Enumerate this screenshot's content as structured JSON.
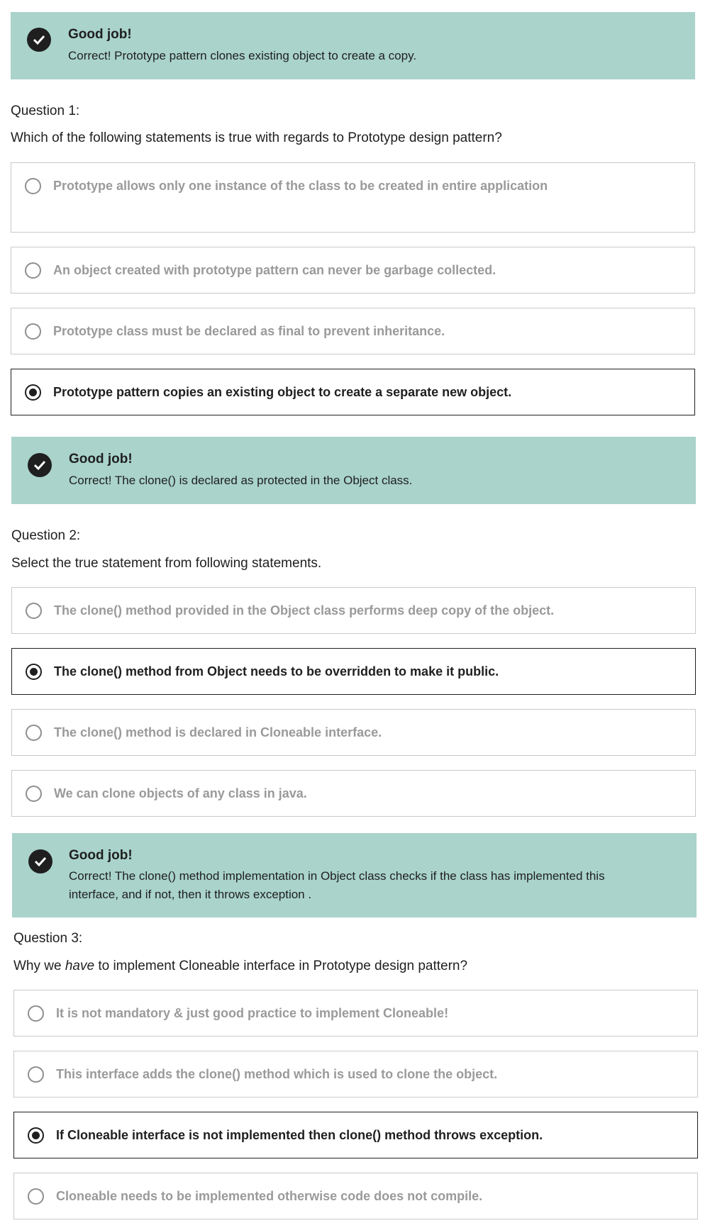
{
  "feedback1": {
    "title": "Good job!",
    "text": "Correct! Prototype pattern clones existing object to create a copy.",
    "icon": "check-circle-icon"
  },
  "q1": {
    "label": "Question 1:",
    "text": "Which of the following statements is true with regards to Prototype design pattern?",
    "options": [
      "Prototype allows only one instance of the class to be created in entire application",
      "An object created with prototype pattern can never be garbage collected.",
      "Prototype class must be declared as final to prevent inheritance.",
      "Prototype pattern copies an existing object to create a separate new object."
    ],
    "selected_index": 3
  },
  "feedback2": {
    "title": "Good job!",
    "text": "Correct! The clone() is declared as protected in the Object class.",
    "icon": "check-circle-icon"
  },
  "q2": {
    "label": "Question 2:",
    "text": "Select the true statement from following statements.",
    "options": [
      "The clone() method provided in the Object class performs deep copy of the object.",
      "The clone() method from Object needs to be overridden to make it public.",
      "The clone() method is declared in Cloneable interface.",
      "We can clone objects of any class in java."
    ],
    "selected_index": 1
  },
  "feedback3": {
    "title": "Good job!",
    "text": "Correct! The clone() method implementation in Object class checks if the class has implemented this interface, and if not, then it throws exception .",
    "icon": "check-circle-icon"
  },
  "q3": {
    "label": "Question 3:",
    "text_before": "Why we ",
    "text_em": "have",
    "text_after": " to implement Cloneable interface in Prototype design pattern?",
    "options": [
      "It is not mandatory & just good practice to implement Cloneable!",
      "This interface adds the clone() method which is used to clone the object.",
      "If Cloneable interface is not implemented then clone() method throws exception.",
      "Cloneable needs to be implemented otherwise code does not compile."
    ],
    "selected_index": 2
  },
  "colors": {
    "feedback_bg": "#a9d3cb",
    "selected": "#1f1f1f",
    "unselected_text": "#9a9a9a",
    "border": "#c9c9c9"
  }
}
